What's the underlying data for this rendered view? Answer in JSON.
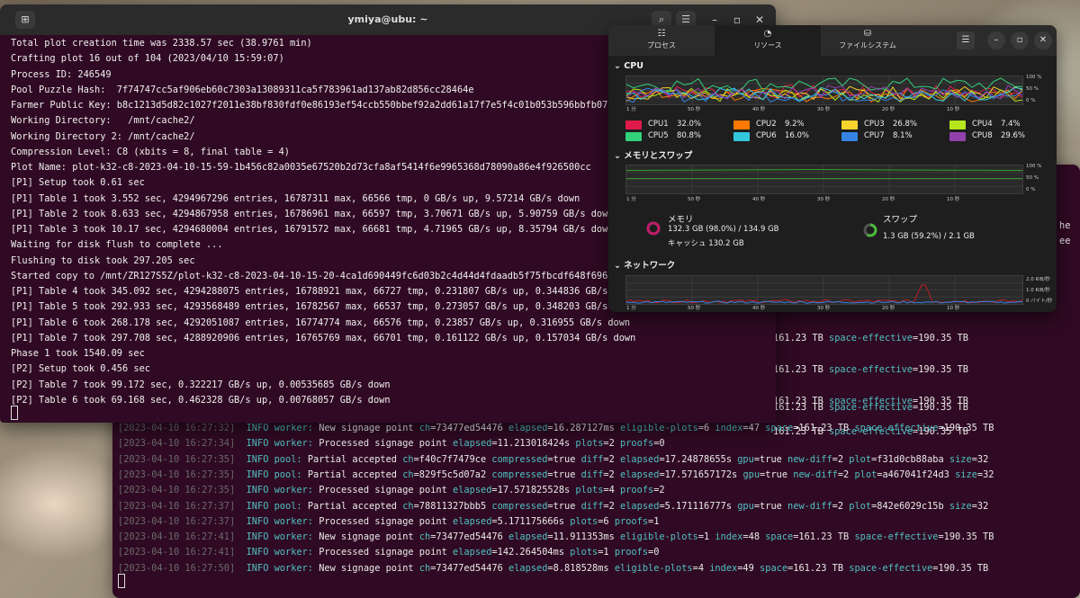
{
  "terminal_front": {
    "title": "ymiya@ubu: ~",
    "lines": [
      "Total plot creation time was 2338.57 sec (38.9761 min)",
      "Crafting plot 16 out of 104 (2023/04/10 15:59:07)",
      "Process ID: 246549",
      "Pool Puzzle Hash:  7f74747cc5af906eb60c7303a13089311ca5f783961ad137ab82d856cc28464e",
      "Farmer Public Key: b8c1213d5d82c1027f2011e38bf830fdf0e86193ef54ccb550bbef92a2dd61a17f7e5f4c01b053b596bbfb07c5ae",
      "Working Directory:   /mnt/cache2/",
      "Working Directory 2: /mnt/cache2/",
      "Compression Level: C8 (xbits = 8, final table = 4)",
      "Plot Name: plot-k32-c8-2023-04-10-15-59-1b456c82a0035e67520b2d73cfa8af5414f6e9965368d78090a86e4f926500cc",
      "[P1] Setup took 0.61 sec",
      "[P1] Table 1 took 3.552 sec, 4294967296 entries, 16787311 max, 66566 tmp, 0 GB/s up, 9.57214 GB/s down",
      "[P1] Table 2 took 8.633 sec, 4294867958 entries, 16786961 max, 66597 tmp, 3.70671 GB/s up, 5.90759 GB/s down",
      "[P1] Table 3 took 10.17 sec, 4294680004 entries, 16791572 max, 66681 tmp, 4.71965 GB/s up, 8.35794 GB/s down",
      "Waiting for disk flush to complete ...",
      "Flushing to disk took 297.205 sec",
      "Started copy to /mnt/ZR127S5Z/plot-k32-c8-2023-04-10-15-20-4ca1d690449fc6d03b2c4d44d4fdaadb5f75fbcdf648f69662a5",
      "[P1] Table 4 took 345.092 sec, 4294288075 entries, 16788921 max, 66727 tmp, 0.231807 GB/s up, 0.344836 GB/s down",
      "[P1] Table 5 took 292.933 sec, 4293568489 entries, 16782567 max, 66537 tmp, 0.273057 GB/s up, 0.348203 GB/s down",
      "[P1] Table 6 took 268.178 sec, 4292051087 entries, 16774774 max, 66576 tmp, 0.23857 GB/s up, 0.316955 GB/s down",
      "[P1] Table 7 took 297.708 sec, 4288920906 entries, 16765769 max, 66701 tmp, 0.161122 GB/s up, 0.157034 GB/s down",
      "Phase 1 took 1540.09 sec",
      "[P2] Setup took 0.456 sec",
      "[P2] Table 7 took 99.172 sec, 0.322217 GB/s up, 0.00535685 GB/s down",
      "[P2] Table 6 took 69.168 sec, 0.462328 GB/s up, 0.00768057 GB/s down"
    ]
  },
  "terminal_back": {
    "right_edge_text": [
      "he",
      "ee"
    ],
    "partial_lines": [
      {
        "prefix": "161.23 TB ",
        "key": "space-effective",
        "val": "=190.35 TB"
      },
      {
        "prefix": "161.23 TB ",
        "key": "space-effective",
        "val": "=190.35 TB"
      },
      {
        "prefix": "161.23 TB ",
        "key": "space-effective",
        "val": "=190.35 TB"
      },
      {
        "prefix": "161.23 TB ",
        "key": "space-effective",
        "val": "=190.35 TB"
      },
      {
        "prefix": "161.23 TB ",
        "key": "space-effective",
        "val": "=190.35 TB"
      }
    ],
    "log_lines": [
      {
        "ts": "[2023-04-10 16:27:32]",
        "level": "INFO",
        "src": "worker:",
        "msg": "New signage point ",
        "pairs": [
          [
            "ch",
            "=73477ed54476 "
          ],
          [
            "elapsed",
            "=16.287127ms "
          ],
          [
            "eligible-plots",
            "=6 "
          ],
          [
            "index",
            "=47 "
          ],
          [
            "space",
            "=161.23 TB "
          ],
          [
            "space-effective",
            "=190.35 TB"
          ]
        ]
      },
      {
        "ts": "[2023-04-10 16:27:34]",
        "level": "INFO",
        "src": "worker:",
        "msg": "Processed signage point ",
        "pairs": [
          [
            "elapsed",
            "=11.213018424s "
          ],
          [
            "plots",
            "=2 "
          ],
          [
            "proofs",
            "=0"
          ]
        ]
      },
      {
        "ts": "[2023-04-10 16:27:35]",
        "level": "INFO",
        "src": "pool:",
        "msg": "Partial accepted ",
        "pairs": [
          [
            "ch",
            "=f40c7f7479ce "
          ],
          [
            "compressed",
            "=true "
          ],
          [
            "diff",
            "=2 "
          ],
          [
            "elapsed",
            "=17.24878655s "
          ],
          [
            "gpu",
            "=true "
          ],
          [
            "new-diff",
            "=2 "
          ],
          [
            "plot",
            "=f31d0cb88aba "
          ],
          [
            "size",
            "=32"
          ]
        ]
      },
      {
        "ts": "[2023-04-10 16:27:35]",
        "level": "INFO",
        "src": "pool:",
        "msg": "Partial accepted ",
        "pairs": [
          [
            "ch",
            "=829f5c5d07a2 "
          ],
          [
            "compressed",
            "=true "
          ],
          [
            "diff",
            "=2 "
          ],
          [
            "elapsed",
            "=17.571657172s "
          ],
          [
            "gpu",
            "=true "
          ],
          [
            "new-diff",
            "=2 "
          ],
          [
            "plot",
            "=a467041f24d3 "
          ],
          [
            "size",
            "=32"
          ]
        ]
      },
      {
        "ts": "[2023-04-10 16:27:35]",
        "level": "INFO",
        "src": "worker:",
        "msg": "Processed signage point ",
        "pairs": [
          [
            "elapsed",
            "=17.571825528s "
          ],
          [
            "plots",
            "=4 "
          ],
          [
            "proofs",
            "=2"
          ]
        ]
      },
      {
        "ts": "[2023-04-10 16:27:37]",
        "level": "INFO",
        "src": "pool:",
        "msg": "Partial accepted ",
        "pairs": [
          [
            "ch",
            "=78811327bbb5 "
          ],
          [
            "compressed",
            "=true "
          ],
          [
            "diff",
            "=2 "
          ],
          [
            "elapsed",
            "=5.171116777s "
          ],
          [
            "gpu",
            "=true "
          ],
          [
            "new-diff",
            "=2 "
          ],
          [
            "plot",
            "=842e6029c15b "
          ],
          [
            "size",
            "=32"
          ]
        ]
      },
      {
        "ts": "[2023-04-10 16:27:37]",
        "level": "INFO",
        "src": "worker:",
        "msg": "Processed signage point ",
        "pairs": [
          [
            "elapsed",
            "=5.171175666s "
          ],
          [
            "plots",
            "=6 "
          ],
          [
            "proofs",
            "=1"
          ]
        ]
      },
      {
        "ts": "[2023-04-10 16:27:41]",
        "level": "INFO",
        "src": "worker:",
        "msg": "New signage point ",
        "pairs": [
          [
            "ch",
            "=73477ed54476 "
          ],
          [
            "elapsed",
            "=11.911353ms "
          ],
          [
            "eligible-plots",
            "=1 "
          ],
          [
            "index",
            "=48 "
          ],
          [
            "space",
            "=161.23 TB "
          ],
          [
            "space-effective",
            "=190.35 TB"
          ]
        ]
      },
      {
        "ts": "[2023-04-10 16:27:41]",
        "level": "INFO",
        "src": "worker:",
        "msg": "Processed signage point ",
        "pairs": [
          [
            "elapsed",
            "=142.264504ms "
          ],
          [
            "plots",
            "=1 "
          ],
          [
            "proofs",
            "=0"
          ]
        ]
      },
      {
        "ts": "[2023-04-10 16:27:50]",
        "level": "INFO",
        "src": "worker:",
        "msg": "New signage point ",
        "pairs": [
          [
            "ch",
            "=73477ed54476 "
          ],
          [
            "elapsed",
            "=8.818528ms "
          ],
          [
            "eligible-plots",
            "=4 "
          ],
          [
            "index",
            "=49 "
          ],
          [
            "space",
            "=161.23 TB "
          ],
          [
            "space-effective",
            "=190.35 TB"
          ]
        ]
      }
    ]
  },
  "monitor": {
    "tabs": [
      {
        "label": "プロセス",
        "icon": "list-icon"
      },
      {
        "label": "リソース",
        "icon": "gauge-icon"
      },
      {
        "label": "ファイルシステム",
        "icon": "disk-icon"
      }
    ],
    "menu_icon": "☰",
    "cpu_title": "CPU",
    "mem_title": "メモリとスワップ",
    "net_title": "ネットワーク",
    "pct_labels": [
      "100 %",
      "50 %",
      "0 %"
    ],
    "net_labels": [
      "2.0 KiB/秒",
      "1.0 KiB/秒",
      "0 バイト/秒"
    ],
    "time_labels": [
      "1 分",
      "50 秒",
      "40 秒",
      "30 秒",
      "20 秒",
      "10 秒"
    ],
    "cpus": [
      {
        "name": "CPU1",
        "value": "32.0%",
        "color": "#e01b4c"
      },
      {
        "name": "CPU2",
        "value": "9.2%",
        "color": "#ff7800"
      },
      {
        "name": "CPU3",
        "value": "26.8%",
        "color": "#f6d32d"
      },
      {
        "name": "CPU4",
        "value": "7.4%",
        "color": "#b5e61d"
      },
      {
        "name": "CPU5",
        "value": "80.8%",
        "color": "#33d17a"
      },
      {
        "name": "CPU6",
        "value": "16.0%",
        "color": "#33c7de"
      },
      {
        "name": "CPU7",
        "value": "8.1%",
        "color": "#3584e4"
      },
      {
        "name": "CPU8",
        "value": "29.6%",
        "color": "#9141ac"
      }
    ],
    "memory": {
      "label": "メモリ",
      "usage": "132.3 GB (98.0%) / 134.9 GB",
      "cache": "キャッシュ 130.2 GB",
      "fraction": 0.98,
      "color": "#c01c6a"
    },
    "swap": {
      "label": "スワップ",
      "usage": "1.3 GB (59.2%) / 2.1 GB",
      "fraction": 0.592,
      "color": "#4ab93a"
    }
  }
}
